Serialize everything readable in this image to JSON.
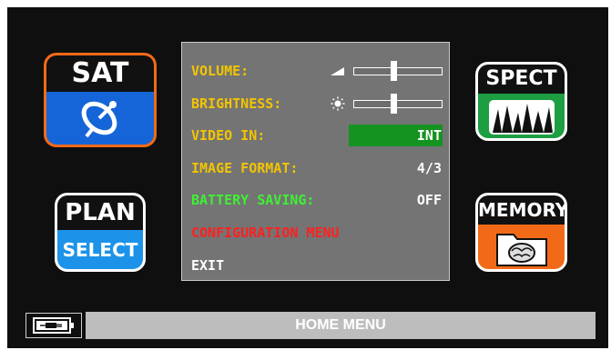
{
  "tiles": {
    "sat": {
      "label": "SAT",
      "icon": "satellite-dish-icon",
      "accent": "#f26a17"
    },
    "plan": {
      "label": "PLAN",
      "sub_label": "SELECT"
    },
    "spect": {
      "label": "SPECT",
      "icon": "spectrum-icon"
    },
    "memory": {
      "label": "MEMORY",
      "icon": "brain-folder-icon"
    }
  },
  "menu": {
    "volume": {
      "label": "VOLUME:",
      "level": 0.45
    },
    "brightness": {
      "label": "BRIGHTNESS:",
      "level": 0.45
    },
    "video_in": {
      "label": "VIDEO IN:",
      "value": "INT"
    },
    "image_format": {
      "label": "IMAGE FORMAT:",
      "value": "4/3"
    },
    "battery_saving": {
      "label": "BATTERY SAVING:",
      "value": "OFF"
    },
    "configuration": {
      "label": "CONFIGURATION MENU"
    },
    "exit": {
      "label": "EXIT"
    }
  },
  "status_bar": {
    "title": "HOME MENU",
    "battery_icon": "battery-plug-icon"
  },
  "colors": {
    "label_yellow": "#f2c400",
    "label_green": "#3ef033",
    "label_red": "#ff2020",
    "highlight_green": "#149321",
    "menu_bg": "#747474"
  }
}
